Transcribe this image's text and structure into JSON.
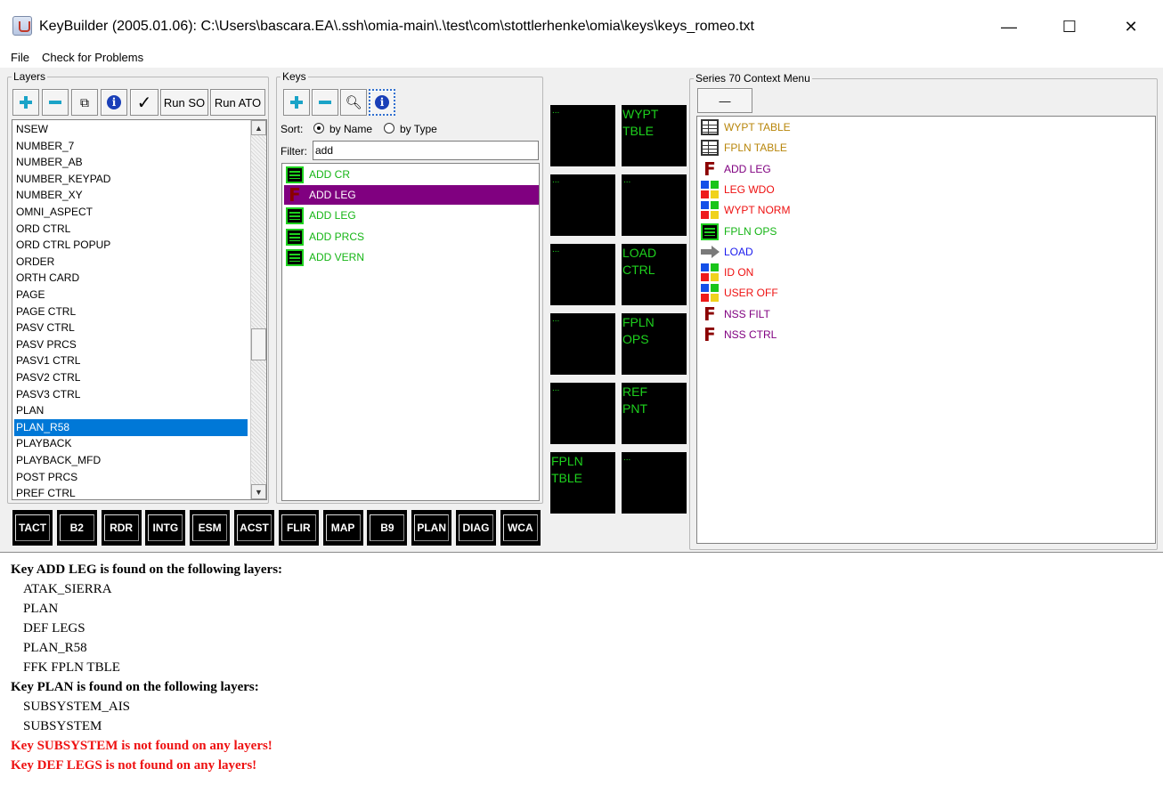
{
  "window": {
    "title": "KeyBuilder (2005.01.06): C:\\Users\\bascara.EA\\.ssh\\omia-main\\.\\test\\com\\stottlerhenke\\omia\\keys\\keys_romeo.txt",
    "minimize": "—",
    "maximize": "☐",
    "close": "✕"
  },
  "menu": {
    "file": "File",
    "check": "Check for Problems"
  },
  "layers": {
    "legend": "Layers",
    "run_so": "Run SO",
    "run_ato": "Run ATO",
    "items": [
      "NSEW",
      "NUMBER_7",
      "NUMBER_AB",
      "NUMBER_KEYPAD",
      "NUMBER_XY",
      "OMNI_ASPECT",
      "ORD CTRL",
      "ORD CTRL POPUP",
      "ORDER",
      "ORTH CARD",
      "PAGE",
      "PAGE CTRL",
      "PASV CTRL",
      "PASV PRCS",
      "PASV1 CTRL",
      "PASV2 CTRL",
      "PASV3 CTRL",
      "PLAN",
      "PLAN_R58",
      "PLAYBACK",
      "PLAYBACK_MFD",
      "POST PRCS",
      "PREF CTRL"
    ],
    "selected": "PLAN_R58"
  },
  "keys": {
    "legend": "Keys",
    "sort_label": "Sort:",
    "by_name": "by Name",
    "by_type": "by Type",
    "sort_selected": "by Name",
    "filter_label": "Filter:",
    "filter_value": "add",
    "items": [
      {
        "label": "ADD CR",
        "icon": "green-list-icon"
      },
      {
        "label": "ADD LEG",
        "icon": "f-function-icon",
        "selected": true
      },
      {
        "label": "ADD LEG",
        "icon": "green-list-icon"
      },
      {
        "label": "ADD PRCS",
        "icon": "green-list-icon"
      },
      {
        "label": "ADD VERN",
        "icon": "green-list-icon"
      }
    ]
  },
  "softkeys": {
    "left": [
      "...",
      "...",
      "...",
      "...",
      "...",
      "FPLN\nTBLE"
    ],
    "right": [
      "WYPT\nTBLE",
      "...",
      "LOAD\nCTRL",
      "FPLN\nOPS",
      "REF\nPNT",
      "..."
    ]
  },
  "tabs": [
    "TACT",
    "B2",
    "RDR",
    "INTG",
    "ESM",
    "ACST",
    "FLIR",
    "MAP",
    "B9",
    "PLAN",
    "DIAG",
    "WCA"
  ],
  "context_menu": {
    "legend": "Series 70 Context Menu",
    "remove_button": "—",
    "items": [
      {
        "label": "WYPT TABLE",
        "icon": "table-icon",
        "color": "#b8860b"
      },
      {
        "label": "FPLN TABLE",
        "icon": "table-icon",
        "color": "#b8860b"
      },
      {
        "label": "ADD LEG",
        "icon": "f-function-icon",
        "color": "#800080"
      },
      {
        "label": "LEG WDO",
        "icon": "color-quad-icon",
        "color": "#ee1111"
      },
      {
        "label": "WYPT NORM",
        "icon": "color-quad-icon",
        "color": "#ee1111"
      },
      {
        "label": "FPLN OPS",
        "icon": "green-list-icon",
        "color": "#15b515"
      },
      {
        "label": "LOAD",
        "icon": "arrow-right-icon",
        "color": "#1a1aee"
      },
      {
        "label": "ID ON",
        "icon": "color-quad-icon",
        "color": "#ee1111"
      },
      {
        "label": "USER OFF",
        "icon": "color-quad-icon",
        "color": "#ee1111"
      },
      {
        "label": "NSS FILT",
        "icon": "f-function-icon",
        "color": "#800080"
      },
      {
        "label": "NSS CTRL",
        "icon": "f-function-icon",
        "color": "#800080"
      }
    ]
  },
  "output": [
    {
      "text": "Key ADD LEG is found on the following layers:",
      "kind": "head"
    },
    {
      "text": "ATAK_SIERRA",
      "kind": "sub"
    },
    {
      "text": "PLAN",
      "kind": "sub"
    },
    {
      "text": "DEF LEGS",
      "kind": "sub"
    },
    {
      "text": "PLAN_R58",
      "kind": "sub"
    },
    {
      "text": "FFK FPLN TBLE",
      "kind": "sub"
    },
    {
      "text": "Key PLAN is found on the following layers:",
      "kind": "head"
    },
    {
      "text": "SUBSYSTEM_AIS",
      "kind": "sub"
    },
    {
      "text": "SUBSYSTEM",
      "kind": "sub"
    },
    {
      "text": "Key SUBSYSTEM is not found on any layers!",
      "kind": "err"
    },
    {
      "text": "Key DEF LEGS is not found on any layers!",
      "kind": "err"
    }
  ]
}
